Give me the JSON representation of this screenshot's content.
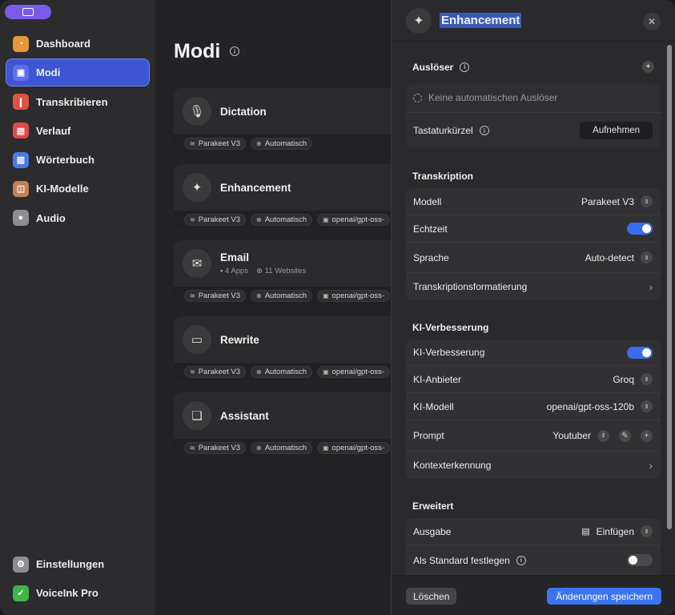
{
  "sidebar": {
    "items": [
      {
        "label": "Dashboard",
        "icon": "dashboard-icon",
        "color": "#e8963a",
        "glyph": "◔"
      },
      {
        "label": "Modi",
        "icon": "modes-icon",
        "color": "#5b6ff0",
        "glyph": "▣"
      },
      {
        "label": "Transkribieren",
        "icon": "waveform-icon",
        "color": "#e0523f",
        "glyph": "❙"
      },
      {
        "label": "Verlauf",
        "icon": "history-icon",
        "color": "#e04a4a",
        "glyph": "▤"
      },
      {
        "label": "Wörterbuch",
        "icon": "dictionary-icon",
        "color": "#4a7be0",
        "glyph": "▥"
      },
      {
        "label": "KI-Modelle",
        "icon": "ai-models-icon",
        "color": "#c47f52",
        "glyph": "◫"
      },
      {
        "label": "Audio",
        "icon": "mic-icon",
        "color": "#8e8e92",
        "glyph": "●"
      }
    ],
    "bottom": [
      {
        "label": "Einstellungen",
        "icon": "gear-icon",
        "color": "#8e8e92",
        "glyph": "⚙"
      },
      {
        "label": "VoiceInk Pro",
        "icon": "pro-badge-icon",
        "color": "#3fb54a",
        "glyph": "✓"
      }
    ]
  },
  "middle": {
    "title": "Modi",
    "cards": [
      {
        "name": "Dictation",
        "icon": "mic-icon",
        "glyph": "🎙",
        "sub": [],
        "chips": [
          "Parakeet V3",
          "Automatisch"
        ]
      },
      {
        "name": "Enhancement",
        "icon": "sparkle-icon",
        "glyph": "✦",
        "sub": [],
        "chips": [
          "Parakeet V3",
          "Automatisch",
          "openai/gpt-oss-"
        ]
      },
      {
        "name": "Email",
        "icon": "envelope-icon",
        "glyph": "✉",
        "sub": [
          "4 Apps",
          "11 Websites"
        ],
        "chips": [
          "Parakeet V3",
          "Automatisch",
          "openai/gpt-oss-"
        ]
      },
      {
        "name": "Rewrite",
        "icon": "chat-bubble-icon",
        "glyph": "💬",
        "sub": [],
        "chips": [
          "Parakeet V3",
          "Automatisch",
          "openai/gpt-oss-"
        ]
      },
      {
        "name": "Assistant",
        "icon": "conversation-icon",
        "glyph": "🗨",
        "sub": [],
        "chips": [
          "Parakeet V3",
          "Automatisch",
          "openai/gpt-oss-"
        ]
      }
    ]
  },
  "panel": {
    "title": "Enhancement",
    "triggers": {
      "title": "Auslöser",
      "none_text": "Keine automatischen Auslöser",
      "shortcut_label": "Tastaturkürzel",
      "record_button": "Aufnehmen"
    },
    "transcription": {
      "title": "Transkription",
      "model_label": "Modell",
      "model_value": "Parakeet V3",
      "realtime_label": "Echtzeit",
      "realtime_on": true,
      "language_label": "Sprache",
      "language_value": "Auto-detect",
      "format_label": "Transkriptionsformatierung"
    },
    "ai": {
      "title": "KI-Verbesserung",
      "enable_label": "KI-Verbesserung",
      "enable_on": true,
      "provider_label": "KI-Anbieter",
      "provider_value": "Groq",
      "model_label": "KI-Modell",
      "model_value": "openai/gpt-oss-120b",
      "prompt_label": "Prompt",
      "prompt_value": "Youtuber",
      "context_label": "Kontexterkennung"
    },
    "advanced": {
      "title": "Erweitert",
      "output_label": "Ausgabe",
      "output_value": "Einfügen",
      "default_label": "Als Standard festlegen",
      "default_on": false
    },
    "footer": {
      "delete_label": "Löschen",
      "save_label": "Änderungen speichern"
    }
  }
}
